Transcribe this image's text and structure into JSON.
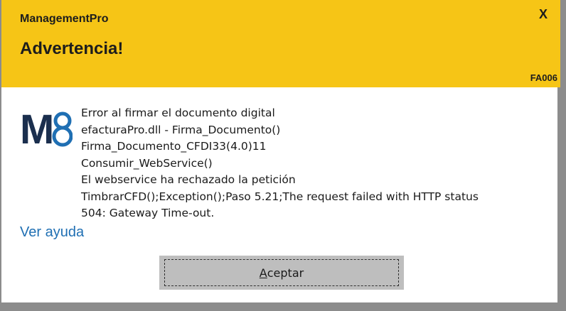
{
  "window": {
    "app_name": "ManagementPro",
    "close_label": "X",
    "title": "Advertencia!",
    "code": "FA006"
  },
  "logo": {
    "icon": "m8-logo-icon",
    "text": "M8"
  },
  "message": {
    "lines": [
      "Error al firmar el documento digital",
      "efacturaPro.dll - Firma_Documento()",
      "Firma_Documento_CFDI33(4.0)11",
      "Consumir_WebService()",
      "El webservice ha rechazado la petición",
      "TimbrarCFD();Exception();Paso 5.21;The request failed with HTTP status",
      "504: Gateway Time-out."
    ]
  },
  "help_link": "Ver ayuda",
  "accept_button": {
    "mnemonic": "A",
    "rest": "ceptar"
  },
  "colors": {
    "header": "#f6c516",
    "logo_dark": "#1b2f4e",
    "logo_accent": "#1f6fb3",
    "link": "#1f6fb3"
  }
}
